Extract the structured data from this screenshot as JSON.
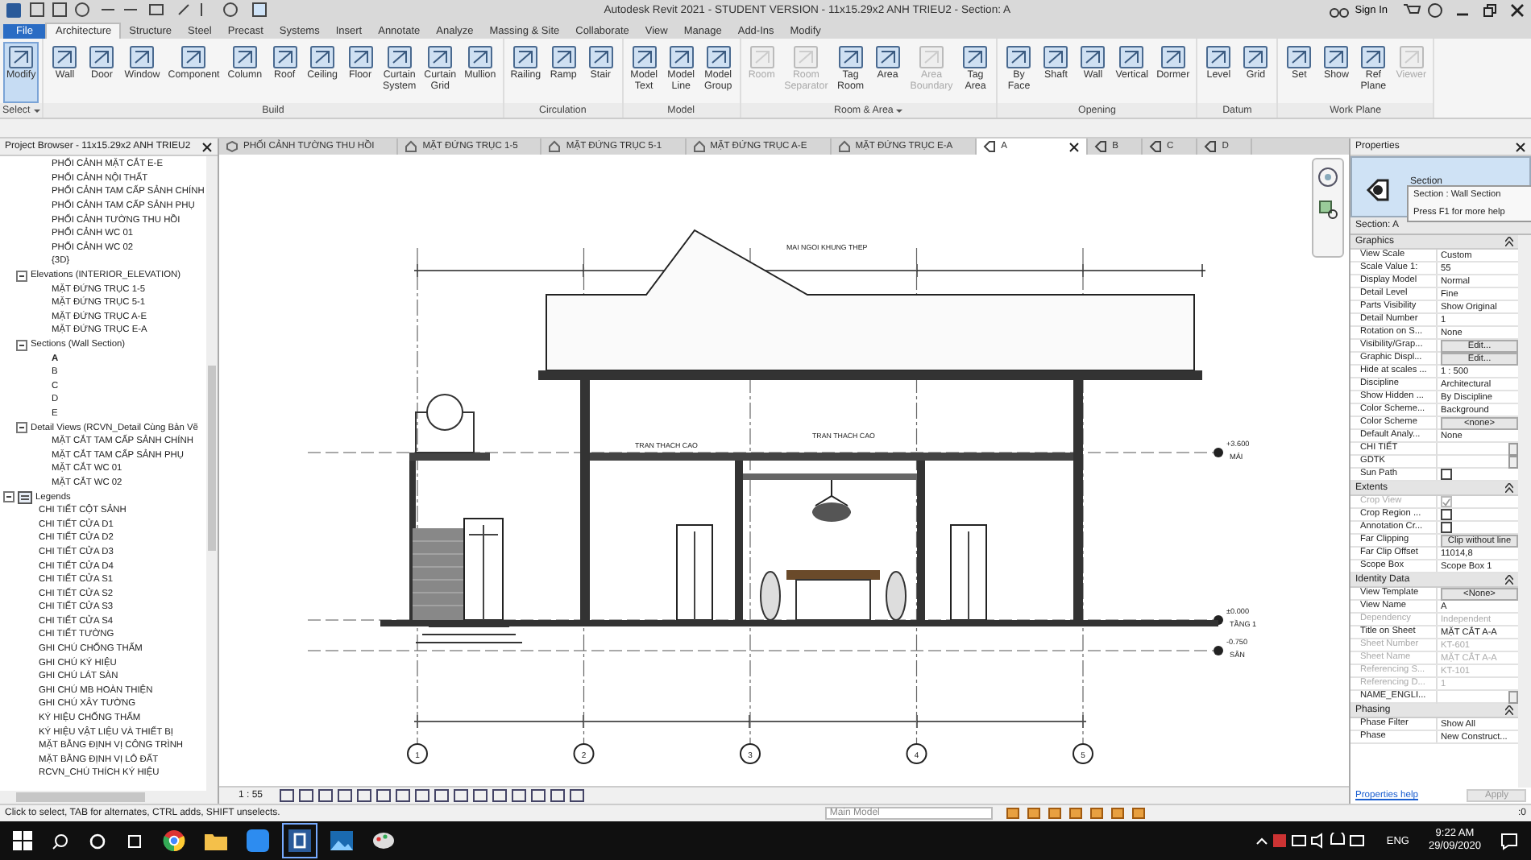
{
  "title_bar": {
    "title": "Autodesk Revit 2021 - STUDENT VERSION - 11x15.29x2 ANH TRIEU2 - Section: A",
    "sign_in": "Sign In"
  },
  "ribbon_tabs": [
    {
      "label": "File",
      "selected": false,
      "kind": "file"
    },
    {
      "label": "Architecture",
      "selected": true,
      "kind": "tab"
    },
    {
      "label": "Structure",
      "selected": false,
      "kind": "tab"
    },
    {
      "label": "Steel",
      "selected": false,
      "kind": "tab"
    },
    {
      "label": "Precast",
      "selected": false,
      "kind": "tab"
    },
    {
      "label": "Systems",
      "selected": false,
      "kind": "tab"
    },
    {
      "label": "Insert",
      "selected": false,
      "kind": "tab"
    },
    {
      "label": "Annotate",
      "selected": false,
      "kind": "tab"
    },
    {
      "label": "Analyze",
      "selected": false,
      "kind": "tab"
    },
    {
      "label": "Massing & Site",
      "selected": false,
      "kind": "tab"
    },
    {
      "label": "Collaborate",
      "selected": false,
      "kind": "tab"
    },
    {
      "label": "View",
      "selected": false,
      "kind": "tab"
    },
    {
      "label": "Manage",
      "selected": false,
      "kind": "tab"
    },
    {
      "label": "Add-Ins",
      "selected": false,
      "kind": "tab"
    },
    {
      "label": "Modify",
      "selected": false,
      "kind": "tab"
    }
  ],
  "ribbon_panels": [
    {
      "label": "Select",
      "menu": true,
      "tools": [
        {
          "label": "Modify",
          "selected": true,
          "disabled": false
        }
      ]
    },
    {
      "label": "Build",
      "menu": false,
      "tools": [
        {
          "label": "Wall",
          "selected": false,
          "disabled": false
        },
        {
          "label": "Door",
          "selected": false,
          "disabled": false
        },
        {
          "label": "Window",
          "selected": false,
          "disabled": false
        },
        {
          "label": "Component",
          "selected": false,
          "disabled": false
        },
        {
          "label": "Column",
          "selected": false,
          "disabled": false
        },
        {
          "label": "Roof",
          "selected": false,
          "disabled": false
        },
        {
          "label": "Ceiling",
          "selected": false,
          "disabled": false
        },
        {
          "label": "Floor",
          "selected": false,
          "disabled": false
        },
        {
          "label": "Curtain System",
          "selected": false,
          "disabled": false
        },
        {
          "label": "Curtain Grid",
          "selected": false,
          "disabled": false
        },
        {
          "label": "Mullion",
          "selected": false,
          "disabled": false
        }
      ]
    },
    {
      "label": "Circulation",
      "menu": false,
      "tools": [
        {
          "label": "Railing",
          "selected": false,
          "disabled": false
        },
        {
          "label": "Ramp",
          "selected": false,
          "disabled": false
        },
        {
          "label": "Stair",
          "selected": false,
          "disabled": false
        }
      ]
    },
    {
      "label": "Model",
      "menu": false,
      "tools": [
        {
          "label": "Model Text",
          "selected": false,
          "disabled": false
        },
        {
          "label": "Model Line",
          "selected": false,
          "disabled": false
        },
        {
          "label": "Model Group",
          "selected": false,
          "disabled": false
        }
      ]
    },
    {
      "label": "Room & Area",
      "menu": true,
      "tools": [
        {
          "label": "Room",
          "selected": false,
          "disabled": true
        },
        {
          "label": "Room Separator",
          "selected": false,
          "disabled": true
        },
        {
          "label": "Tag Room",
          "selected": false,
          "disabled": false
        },
        {
          "label": "Area",
          "selected": false,
          "disabled": false
        },
        {
          "label": "Area Boundary",
          "selected": false,
          "disabled": true
        },
        {
          "label": "Tag Area",
          "selected": false,
          "disabled": false
        }
      ]
    },
    {
      "label": "Opening",
      "menu": false,
      "tools": [
        {
          "label": "By Face",
          "selected": false,
          "disabled": false
        },
        {
          "label": "Shaft",
          "selected": false,
          "disabled": false
        },
        {
          "label": "Wall",
          "selected": false,
          "disabled": false
        },
        {
          "label": "Vertical",
          "selected": false,
          "disabled": false
        },
        {
          "label": "Dormer",
          "selected": false,
          "disabled": false
        }
      ]
    },
    {
      "label": "Datum",
      "menu": false,
      "tools": [
        {
          "label": "Level",
          "selected": false,
          "disabled": false
        },
        {
          "label": "Grid",
          "selected": false,
          "disabled": false
        }
      ]
    },
    {
      "label": "Work Plane",
      "menu": false,
      "tools": [
        {
          "label": "Set",
          "selected": false,
          "disabled": false
        },
        {
          "label": "Show",
          "selected": false,
          "disabled": false
        },
        {
          "label": "Ref Plane",
          "selected": false,
          "disabled": false
        },
        {
          "label": "Viewer",
          "selected": false,
          "disabled": true
        }
      ]
    }
  ],
  "project_browser": {
    "title": "Project Browser - 11x15.29x2 ANH TRIEU2",
    "views": {
      "items": [
        {
          "label": "PHỐI CẢNH MẶT CẮT E-E",
          "selected": false
        },
        {
          "label": "PHỐI CẢNH NỘI THẤT",
          "selected": false
        },
        {
          "label": "PHỐI CẢNH TAM CẤP SẢNH CHÍNH",
          "selected": false
        },
        {
          "label": "PHỐI CẢNH TAM CẤP SẢNH PHỤ",
          "selected": false
        },
        {
          "label": "PHỐI CẢNH TƯỜNG THU HỒI",
          "selected": false
        },
        {
          "label": "PHỐI CẢNH WC 01",
          "selected": false
        },
        {
          "label": "PHỐI CẢNH WC 02",
          "selected": false
        },
        {
          "label": "{3D}",
          "selected": false
        }
      ],
      "groups": [
        {
          "label": "Elevations (INTERIOR_ELEVATION)",
          "expanded": true,
          "children": [
            {
              "label": "MẶT ĐỨNG TRỤC 1-5",
              "selected": false
            },
            {
              "label": "MẶT ĐỨNG TRỤC 5-1",
              "selected": false
            },
            {
              "label": "MẶT ĐỨNG TRỤC A-E",
              "selected": false
            },
            {
              "label": "MẶT ĐỨNG TRỤC E-A",
              "selected": false
            }
          ]
        },
        {
          "label": "Sections (Wall Section)",
          "expanded": true,
          "children": [
            {
              "label": "A",
              "selected": true
            },
            {
              "label": "B",
              "selected": false
            },
            {
              "label": "C",
              "selected": false
            },
            {
              "label": "D",
              "selected": false
            },
            {
              "label": "E",
              "selected": false
            }
          ]
        },
        {
          "label": "Detail Views (RCVN_Detail Cùng Bản Vẽ",
          "expanded": true,
          "children": [
            {
              "label": "MẶT CẮT TAM CẤP SẢNH CHÍNH",
              "selected": false
            },
            {
              "label": "MẶT CẮT TAM CẤP SẢNH PHỤ",
              "selected": false
            },
            {
              "label": "MẶT CẮT WC 01",
              "selected": false
            },
            {
              "label": "MẶT CẮT WC 02",
              "selected": false
            }
          ]
        }
      ]
    },
    "legends": {
      "label": "Legends",
      "expanded": true,
      "children": [
        {
          "label": "CHI TIẾT CỘT SẢNH",
          "selected": false
        },
        {
          "label": "CHI TIẾT CỬA D1",
          "selected": false
        },
        {
          "label": "CHI TIẾT CỬA D2",
          "selected": false
        },
        {
          "label": "CHI TIẾT CỬA D3",
          "selected": false
        },
        {
          "label": "CHI TIẾT CỬA D4",
          "selected": false
        },
        {
          "label": "CHI TIẾT CỬA S1",
          "selected": false
        },
        {
          "label": "CHI TIẾT CỬA S2",
          "selected": false
        },
        {
          "label": "CHI TIẾT CỬA S3",
          "selected": false
        },
        {
          "label": "CHI TIẾT CỬA S4",
          "selected": false
        },
        {
          "label": "CHI TIẾT TƯỜNG",
          "selected": false
        },
        {
          "label": "GHI CHÚ CHỐNG THẤM",
          "selected": false
        },
        {
          "label": "GHI CHÚ KÝ HIỆU",
          "selected": false
        },
        {
          "label": "GHI CHÚ LÁT SÀN",
          "selected": false
        },
        {
          "label": "GHI CHÚ MB HOÀN THIỆN",
          "selected": false
        },
        {
          "label": "GHI CHÚ XÂY TƯỜNG",
          "selected": false
        },
        {
          "label": "KÝ HIỆU CHỐNG THẤM",
          "selected": false
        },
        {
          "label": "KÝ HIỆU VẬT LIỆU VÀ THIẾT BỊ",
          "selected": false
        },
        {
          "label": "MẶT BẰNG ĐỊNH VỊ CÔNG TRÌNH",
          "selected": false
        },
        {
          "label": "MẶT BẰNG ĐỊNH VỊ LÔ ĐẤT",
          "selected": false
        },
        {
          "label": "RCVN_CHÚ THÍCH KÝ HIỆU",
          "selected": false
        }
      ]
    }
  },
  "view_tabs": [
    {
      "label": "PHỐI CẢNH TƯỜNG THU HỒI",
      "kind": "perspective",
      "selected": false
    },
    {
      "label": "MẶT ĐỨNG TRỤC 1-5",
      "kind": "elevation",
      "selected": false
    },
    {
      "label": "MẶT ĐỨNG TRỤC 5-1",
      "kind": "elevation",
      "selected": false
    },
    {
      "label": "MẶT ĐỨNG TRỤC A-E",
      "kind": "elevation",
      "selected": false
    },
    {
      "label": "MẶT ĐỨNG TRỤC E-A",
      "kind": "elevation",
      "selected": false
    },
    {
      "label": "A",
      "kind": "section",
      "selected": true
    },
    {
      "label": "B",
      "kind": "section",
      "selected": false
    },
    {
      "label": "C",
      "kind": "section",
      "selected": false
    },
    {
      "label": "D",
      "kind": "section",
      "selected": false
    }
  ],
  "drawing": {
    "roof_note": "MAI NGOI KHUNG THEP",
    "ceiling_notes": [
      "TRAN THACH CAO",
      "TRAN THACH CAO"
    ],
    "grid_labels": [
      "1",
      "2",
      "3",
      "4",
      "5"
    ],
    "levels": [
      {
        "name": "MÁI",
        "elevation": "+3.600"
      },
      {
        "name": "TẦNG 1",
        "elevation": "±0.000"
      },
      {
        "name": "SÂN",
        "elevation": "-0.750"
      }
    ]
  },
  "view_control": {
    "scale": "1 : 55"
  },
  "properties": {
    "title": "Properties",
    "type_name": "Section",
    "tooltip": [
      "Section : Wall Section",
      "Press F1 for more help"
    ],
    "selector": "Section: A",
    "groups": [
      {
        "label": "Graphics",
        "rows": [
          {
            "name": "View Scale",
            "value": "Custom",
            "kind": "text",
            "disabled": false
          },
          {
            "name": "Scale Value    1:",
            "value": "55",
            "kind": "text",
            "disabled": false
          },
          {
            "name": "Display Model",
            "value": "Normal",
            "kind": "text",
            "disabled": false
          },
          {
            "name": "Detail Level",
            "value": "Fine",
            "kind": "text",
            "disabled": false
          },
          {
            "name": "Parts Visibility",
            "value": "Show Original",
            "kind": "text",
            "disabled": false
          },
          {
            "name": "Detail Number",
            "value": "1",
            "kind": "text",
            "disabled": false
          },
          {
            "name": "Rotation on S...",
            "value": "None",
            "kind": "text",
            "disabled": false
          },
          {
            "name": "Visibility/Grap...",
            "value": "Edit...",
            "kind": "button",
            "disabled": false
          },
          {
            "name": "Graphic Displ...",
            "value": "Edit...",
            "kind": "button",
            "disabled": false
          },
          {
            "name": "Hide at scales ...",
            "value": "1 : 500",
            "kind": "text",
            "disabled": false
          },
          {
            "name": "Discipline",
            "value": "Architectural",
            "kind": "text",
            "disabled": false
          },
          {
            "name": "Show Hidden ...",
            "value": "By Discipline",
            "kind": "text",
            "disabled": false
          },
          {
            "name": "Color Scheme...",
            "value": "Background",
            "kind": "text",
            "disabled": false
          },
          {
            "name": "Color Scheme",
            "value": "<none>",
            "kind": "button",
            "disabled": false
          },
          {
            "name": "Default Analy...",
            "value": "None",
            "kind": "text",
            "disabled": false
          },
          {
            "name": "CHI TIẾT",
            "kind": "field",
            "disabled": false
          },
          {
            "name": "GDTK",
            "kind": "field",
            "disabled": false
          },
          {
            "name": "Sun Path",
            "kind": "checkbox",
            "checked": false,
            "disabled": false
          }
        ]
      },
      {
        "label": "Extents",
        "rows": [
          {
            "name": "Crop View",
            "kind": "checkbox",
            "checked": true,
            "disabled": true
          },
          {
            "name": "Crop Region ...",
            "kind": "checkbox",
            "checked": false,
            "disabled": false
          },
          {
            "name": "Annotation Cr...",
            "kind": "checkbox",
            "checked": false,
            "disabled": false
          },
          {
            "name": "Far Clipping",
            "value": "Clip without line",
            "kind": "button",
            "disabled": false
          },
          {
            "name": "Far Clip Offset",
            "value": "11014,8",
            "kind": "text",
            "disabled": false
          },
          {
            "name": "Scope Box",
            "value": "Scope Box 1",
            "kind": "text",
            "disabled": false
          }
        ]
      },
      {
        "label": "Identity Data",
        "rows": [
          {
            "name": "View Template",
            "value": "<None>",
            "kind": "button",
            "disabled": false
          },
          {
            "name": "View Name",
            "value": "A",
            "kind": "text",
            "disabled": false
          },
          {
            "name": "Dependency",
            "value": "Independent",
            "kind": "text",
            "disabled": true
          },
          {
            "name": "Title on Sheet",
            "value": "MẶT CẮT A-A",
            "kind": "text",
            "disabled": false
          },
          {
            "name": "Sheet Number",
            "value": "KT-601",
            "kind": "text",
            "disabled": true
          },
          {
            "name": "Sheet Name",
            "value": "MẶT CẮT A-A",
            "kind": "text",
            "disabled": true
          },
          {
            "name": "Referencing S...",
            "value": "KT-101",
            "kind": "text",
            "disabled": true
          },
          {
            "name": "Referencing D...",
            "value": "1",
            "kind": "text",
            "disabled": true
          },
          {
            "name": "NAME_ENGLI...",
            "kind": "field",
            "disabled": false
          }
        ]
      },
      {
        "label": "Phasing",
        "rows": [
          {
            "name": "Phase Filter",
            "value": "Show All",
            "kind": "text",
            "disabled": false
          },
          {
            "name": "Phase",
            "value": "New Construct...",
            "kind": "text",
            "disabled": false
          }
        ]
      }
    ],
    "help": "Properties help",
    "apply": "Apply"
  },
  "status_bar": {
    "message": "Click to select, TAB for alternates, CTRL adds, SHIFT unselects.",
    "model": "Main Model",
    "count": ":0"
  },
  "taskbar": {
    "language": "ENG",
    "time": "9:22 AM",
    "date": "29/09/2020"
  }
}
